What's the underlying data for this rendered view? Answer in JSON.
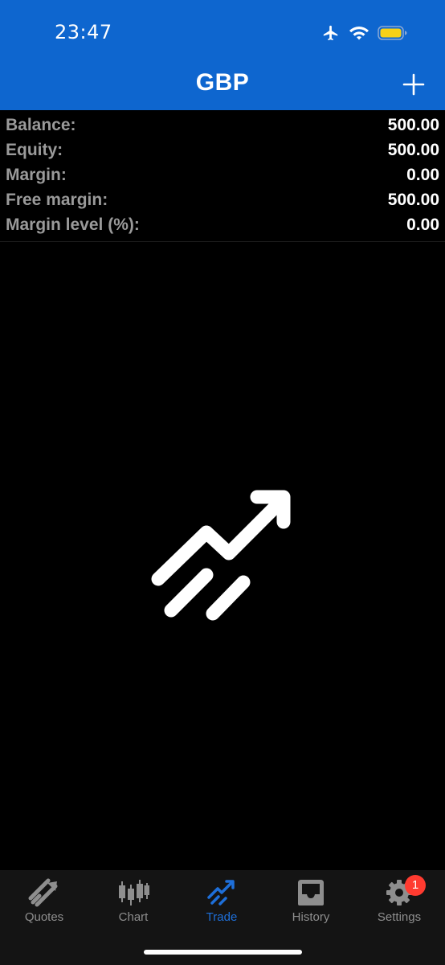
{
  "status": {
    "time": "23:47"
  },
  "header": {
    "title": "GBP"
  },
  "summary": [
    {
      "label": "Balance:",
      "value": "500.00"
    },
    {
      "label": "Equity:",
      "value": "500.00"
    },
    {
      "label": "Margin:",
      "value": "0.00"
    },
    {
      "label": "Free margin:",
      "value": "500.00"
    },
    {
      "label": "Margin level (%):",
      "value": "0.00"
    }
  ],
  "tabs": [
    {
      "label": "Quotes",
      "icon": "quotes-icon"
    },
    {
      "label": "Chart",
      "icon": "candlestick-chart-icon"
    },
    {
      "label": "Trade",
      "icon": "trade-icon",
      "active": true
    },
    {
      "label": "History",
      "icon": "inbox-icon"
    },
    {
      "label": "Settings",
      "icon": "gear-icon",
      "badge": "1"
    }
  ],
  "colors": {
    "header": "#0e66cf",
    "active_tab": "#1e6fd9",
    "badge": "#ff3b30",
    "battery": "#f7d117"
  }
}
